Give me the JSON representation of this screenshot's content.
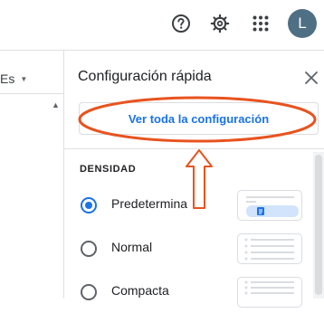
{
  "header": {
    "avatar_initial": "L",
    "help_icon": "help-circle-icon",
    "settings_icon": "gear-icon",
    "apps_icon": "apps-grid-icon"
  },
  "left": {
    "language_selector": "Es"
  },
  "panel": {
    "title": "Configuración rápida",
    "see_all_label": "Ver toda la configuración",
    "density_title": "DENSIDAD",
    "options": [
      {
        "label": "Predetermina",
        "checked": true
      },
      {
        "label": "Normal",
        "checked": false
      },
      {
        "label": "Compacta",
        "checked": false
      }
    ]
  },
  "colors": {
    "accent": "#1a73e8",
    "avatar_bg": "#4f6f85",
    "annotation": "#e8531f",
    "icon_dark": "#3c4043"
  }
}
